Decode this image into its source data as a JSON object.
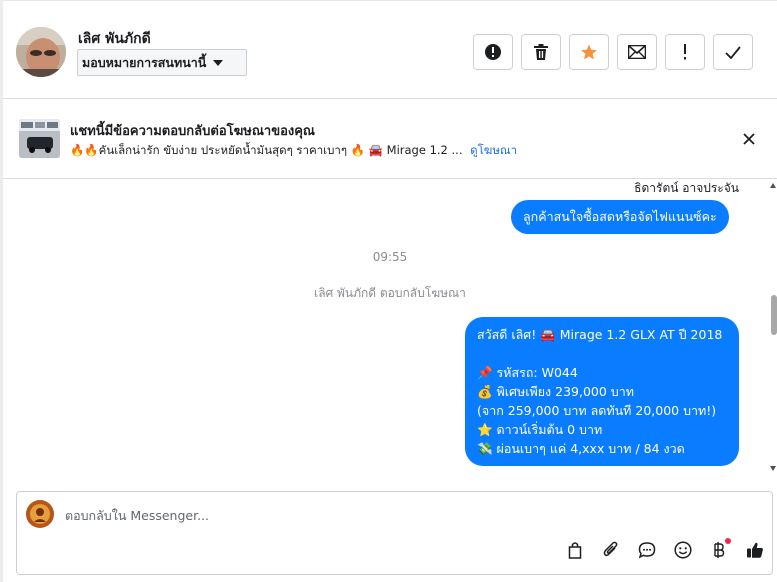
{
  "header": {
    "contact_name": "เลิศ พันภักดี",
    "assign_label": "มอบหมายการสนทนานี้",
    "toolbar": [
      {
        "icon": "alert-circle-icon",
        "label": "Mark as spam"
      },
      {
        "icon": "trash-icon",
        "label": "Delete"
      },
      {
        "icon": "star-icon",
        "label": "Star"
      },
      {
        "icon": "envelope-icon",
        "label": "Mark as unread"
      },
      {
        "icon": "exclamation-icon",
        "label": "Follow up"
      },
      {
        "icon": "check-icon",
        "label": "Done"
      }
    ]
  },
  "ad_banner": {
    "title": "แชทนี้มีข้อความตอบกลับต่อโฆษณาของคุณ",
    "description": "🔥🔥คันเล็กน่ารัก ขับง่าย ประหยัดน้ำมันสุดๆ ราคาเบาๆ 🔥 🚘 Mirage 1.2 ...",
    "link_label": "ดูโฆษณา"
  },
  "conversation": {
    "sender_name": "ธิดารัตน์ อาจประจัน",
    "message1": "ลูกค้าสนใจซื้อสดหรือจัดไฟแนนซ์คะ",
    "timestamp": "09:55",
    "reply_note": "เลิศ พันภักดี ตอบกลับโฆษณา",
    "message2": {
      "line1": "สวัสดี เลิศ! 🚘 Mirage 1.2 GLX AT ปี 2018",
      "line2": "📌 รหัสรถ: W044",
      "line3": "💰 พิเศษเพียง 239,000 บาท",
      "line4": "(จาก 259,000 บาท ลดทันที 20,000 บาท!)",
      "line5": "⭐ ดาวน์เริ่มต้น 0 บาท",
      "line6": "💸 ผ่อนเบาๆ แค่ 4,xxx บาท / 84 งวด"
    }
  },
  "composer": {
    "placeholder": "ตอบกลับใน Messenger...",
    "tools": [
      "bag-icon",
      "paperclip-icon",
      "chat-bubble-icon",
      "emoji-icon",
      "baht-icon",
      "thumbs-up-icon"
    ]
  },
  "colors": {
    "accent": "#0a7cff",
    "star": "#f7923a",
    "link": "#216fdb",
    "notification": "#f02849"
  }
}
